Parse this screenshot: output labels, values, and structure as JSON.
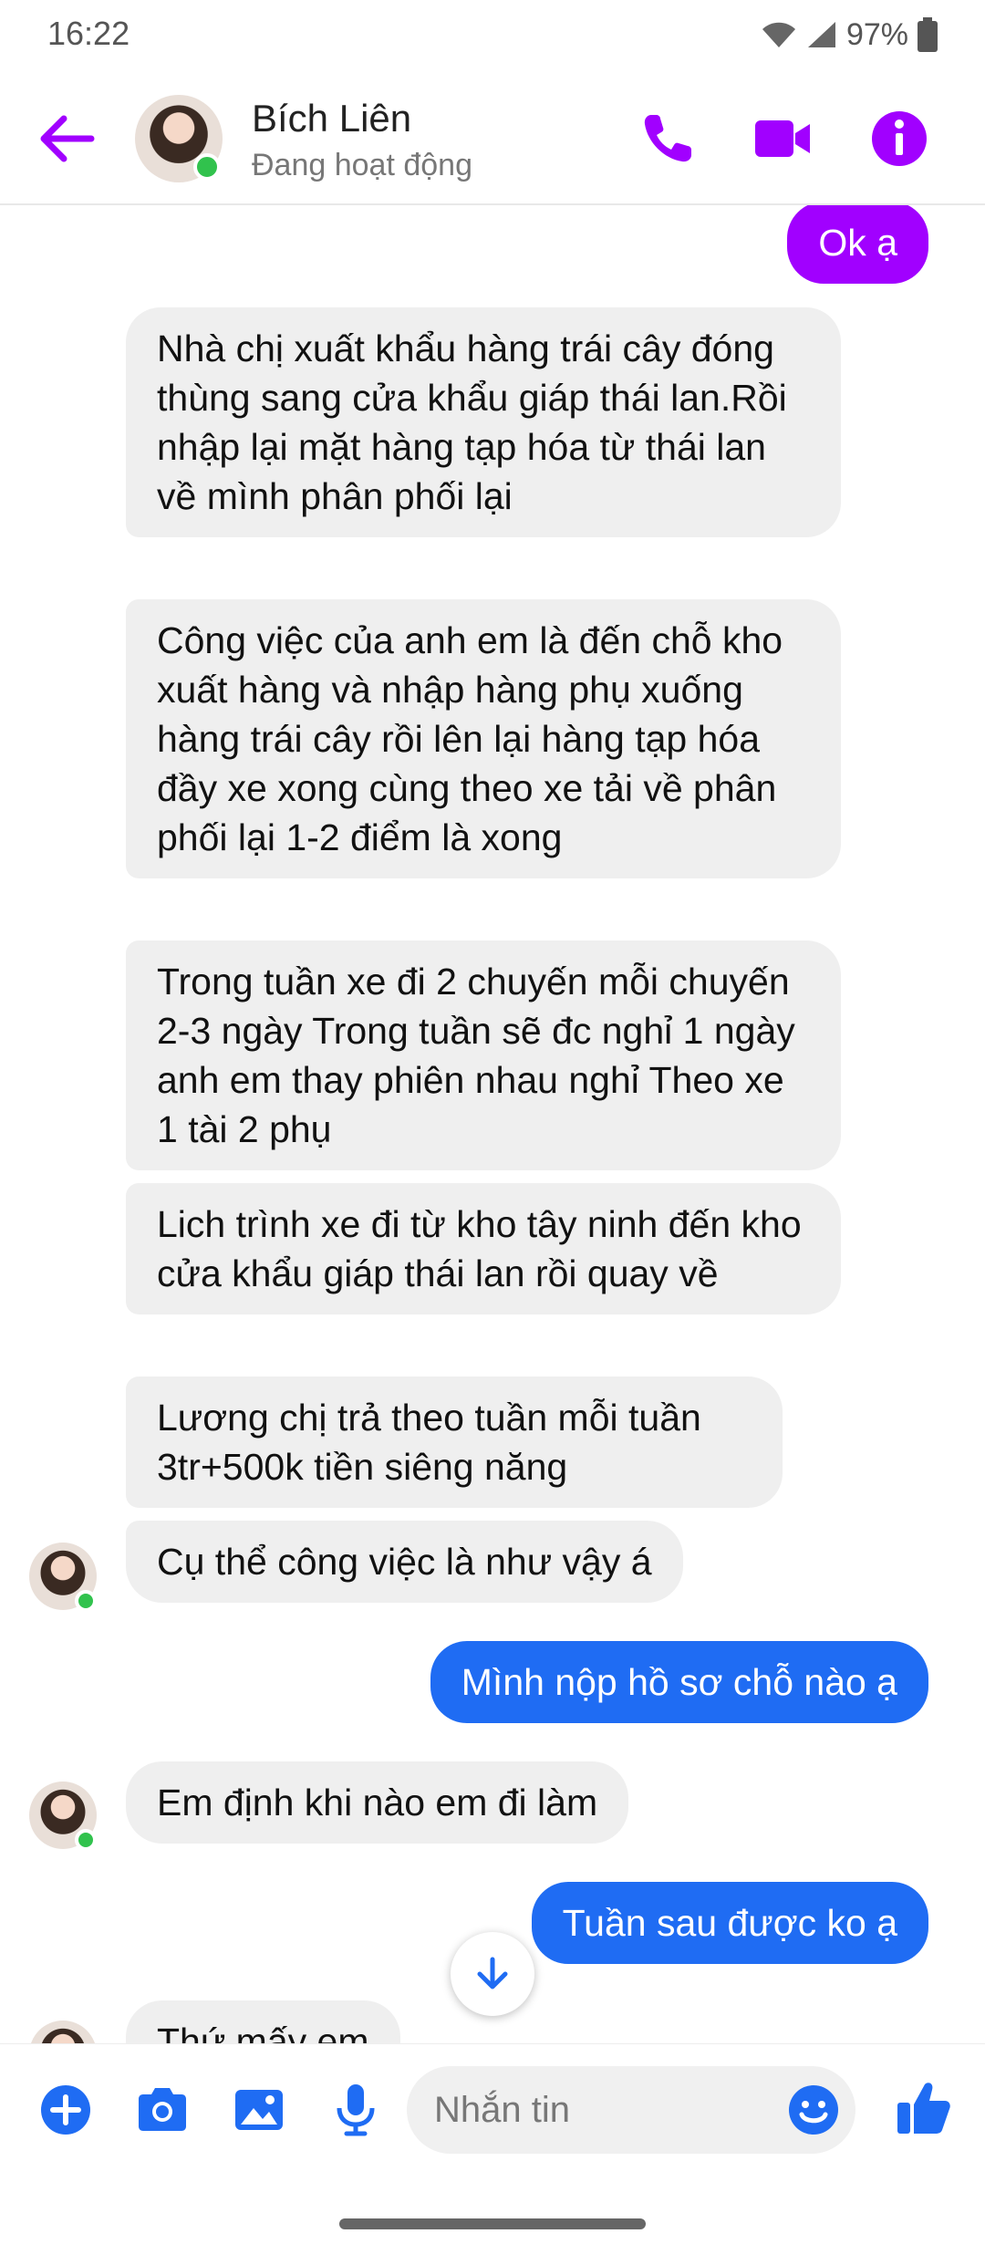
{
  "status_bar": {
    "time": "16:22",
    "battery": "97%"
  },
  "header": {
    "contact_name": "Bích Liên",
    "contact_status": "Đang hoạt động"
  },
  "messages": [
    {
      "side": "out",
      "text": "Ok ạ"
    },
    {
      "side": "in",
      "text": "Nhà chị xuất khẩu hàng trái cây đóng thùng sang cửa khẩu giáp thái lan.Rồi nhập lại mặt hàng tạp hóa từ thái lan về mình phân phối lại"
    },
    {
      "side": "in",
      "text": "Công việc của anh em là đến chỗ kho xuất hàng và nhập hàng phụ xuống hàng trái cây rồi lên lại hàng tạp hóa đầy xe xong cùng theo xe tải về phân phối lại 1-2 điểm là xong"
    },
    {
      "side": "in",
      "text": "Trong tuần xe đi 2 chuyến mỗi chuyến 2-3 ngày Trong tuần sẽ đc nghỉ 1 ngày anh em thay phiên nhau nghỉ Theo xe 1 tài 2 phụ"
    },
    {
      "side": "in",
      "text": "Lich trình xe đi từ kho tây ninh đến kho cửa khẩu giáp thái lan rồi quay về"
    },
    {
      "side": "in",
      "text": "Lương chị trả theo tuần mỗi tuần 3tr+500k tiền siêng năng"
    },
    {
      "side": "in",
      "text": "Cụ thể công việc là như vậy á"
    },
    {
      "side": "out",
      "text": "Mình nộp hồ sơ chỗ nào ạ"
    },
    {
      "side": "in",
      "text": "Em định khi nào em đi làm"
    },
    {
      "side": "out",
      "text": "Tuần sau được ko ạ"
    },
    {
      "side": "in",
      "text": "Thứ mấy em"
    }
  ],
  "composer": {
    "placeholder": "Nhắn tin"
  },
  "colors": {
    "accent": "#a100ff",
    "outgoing_blue": "#1f6cf3",
    "incoming_bg": "#efefef",
    "online": "#31c24d"
  },
  "icons": [
    "back-arrow-icon",
    "phone-icon",
    "video-icon",
    "info-icon",
    "plus-icon",
    "camera-icon",
    "image-icon",
    "microphone-icon",
    "emoji-icon",
    "thumbs-up-icon",
    "arrow-down-icon"
  ]
}
